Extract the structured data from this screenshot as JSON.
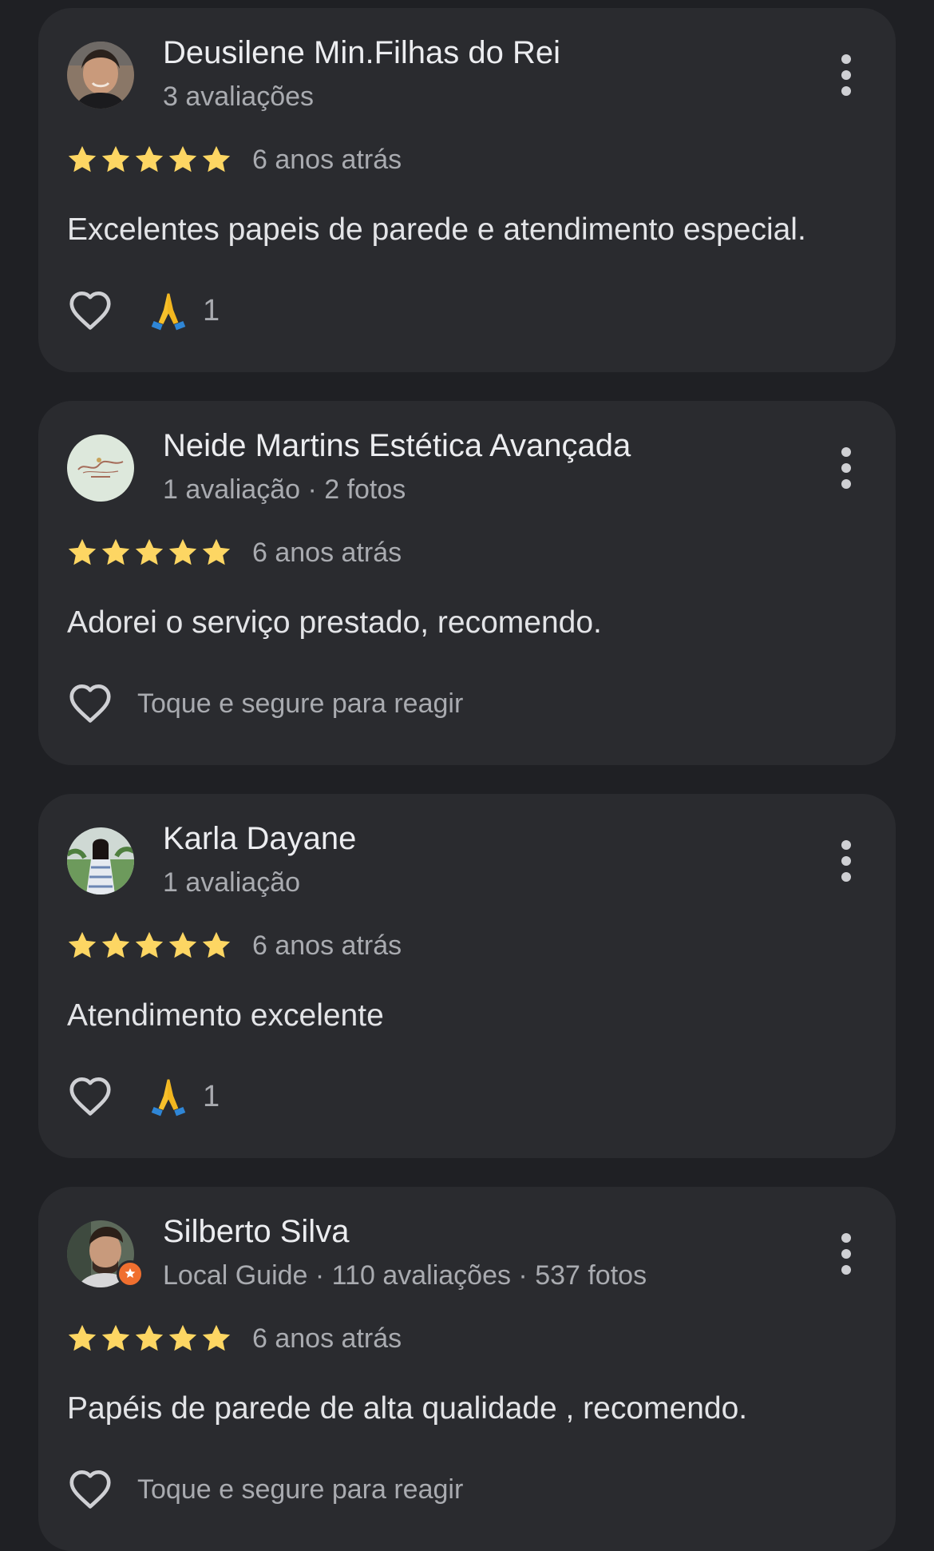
{
  "colors": {
    "background": "#1f2024",
    "card": "#2a2b2f",
    "star": "#fdd663",
    "secondary_text": "#a9abb0",
    "heart_outline": "#cfd0d4"
  },
  "reviews": [
    {
      "name": "Deusilene Min.Filhas do Rei",
      "meta": "3 avaliações",
      "rating": 5,
      "age": "6 anos atrás",
      "text": "Excelentes papeis de parede e atendimento especial.",
      "reaction_emoji": "folded-hands-emoji",
      "reaction_count": "1",
      "avatar_icon": "profile-photo-avatar"
    },
    {
      "name": "Neide Martins Estética Avançada",
      "meta": "1 avaliação · 2 fotos",
      "rating": 5,
      "age": "6 anos atrás",
      "text": "Adorei o serviço prestado, recomendo.",
      "reaction_hint": "Toque e segure para reagir",
      "avatar_icon": "business-logo-avatar"
    },
    {
      "name": "Karla Dayane",
      "meta": "1 avaliação",
      "rating": 5,
      "age": "6 anos atrás",
      "text": "Atendimento excelente",
      "reaction_emoji": "folded-hands-emoji",
      "reaction_count": "1",
      "avatar_icon": "profile-photo-avatar"
    },
    {
      "name": "Silberto Silva",
      "meta": "Local Guide · 110 avaliações · 537 fotos",
      "rating": 5,
      "age": "6 anos atrás",
      "text": "Papéis de parede de alta qualidade , recomendo.",
      "reaction_hint": "Toque e segure para reagir",
      "avatar_icon": "profile-photo-avatar",
      "badge_icon": "local-guide-badge-icon"
    }
  ]
}
